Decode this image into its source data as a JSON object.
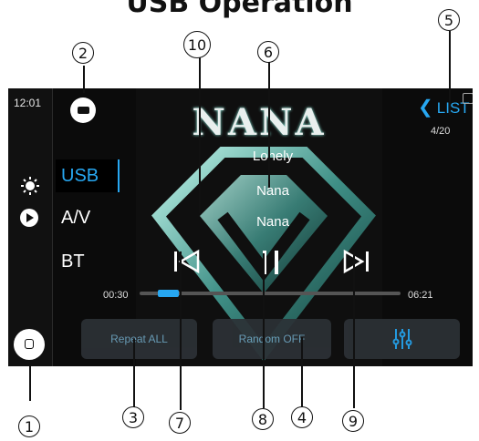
{
  "page_title": "USB Operation",
  "screen": {
    "time": "12:01",
    "sources": [
      {
        "label": "USB",
        "active": true
      },
      {
        "label": "A/V",
        "active": false
      },
      {
        "label": "BT",
        "active": false
      }
    ],
    "artist_logo": "NANA",
    "track": {
      "title": "Lonely",
      "artist": "Nana",
      "album": "Nana"
    },
    "list_label": "LIST",
    "track_count": "4/20",
    "elapsed": "00:30",
    "duration": "06:21",
    "progress": 0.08,
    "repeat_label": "Repeat ALL",
    "random_label": "Random OFF",
    "accent_color": "#27a7f1",
    "icons": [
      "usb-icon",
      "brightness-icon",
      "play-icon",
      "home-icon",
      "eq-icon",
      "prev-icon",
      "pause-icon",
      "next-icon"
    ]
  },
  "callouts": [
    "1",
    "2",
    "3",
    "4",
    "5",
    "6",
    "7",
    "8",
    "9",
    "10"
  ]
}
